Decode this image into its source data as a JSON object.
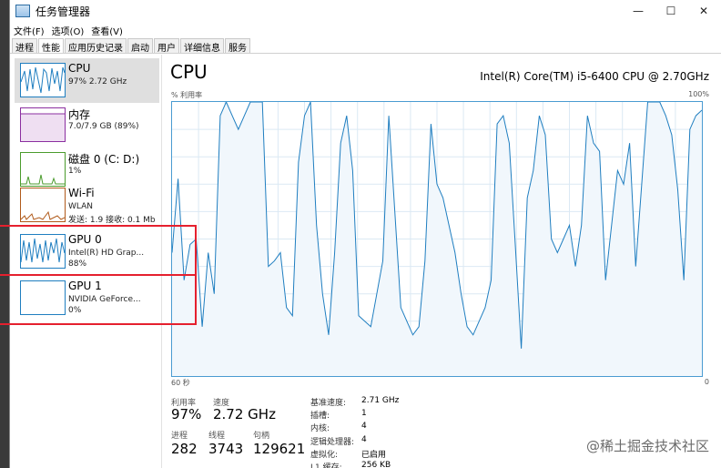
{
  "window": {
    "title": "任务管理器",
    "minimize": "—",
    "maximize": "☐",
    "close": "✕"
  },
  "menu": [
    "文件(F)",
    "选项(O)",
    "查看(V)"
  ],
  "tabs": [
    "进程",
    "性能",
    "应用历史记录",
    "启动",
    "用户",
    "详细信息",
    "服务"
  ],
  "sidebar": [
    {
      "name": "CPU",
      "line2": "97%  2.72 GHz",
      "line3": "",
      "color": "#1f7ec0"
    },
    {
      "name": "内存",
      "line2": "7.0/7.9 GB (89%)",
      "line3": "",
      "color": "#8b2fa0"
    },
    {
      "name": "磁盘 0 (C: D:)",
      "line2": "1%",
      "line3": "",
      "color": "#4b9b2d"
    },
    {
      "name": "Wi-Fi",
      "line2": "WLAN",
      "line3": "发送: 1.9  接收: 0.1 Mb",
      "color": "#b05a1a"
    },
    {
      "name": "GPU 0",
      "line2": "Intel(R) HD Grap...",
      "line3": "88%",
      "color": "#1f7ec0"
    },
    {
      "name": "GPU 1",
      "line2": "NVIDIA GeForce...",
      "line3": "0%",
      "color": "#1f7ec0"
    }
  ],
  "main": {
    "title": "CPU",
    "cpu_name": "Intel(R) Core(TM) i5-6400 CPU @ 2.70GHz",
    "ylabel": "% 利用率",
    "ymax": "100%",
    "xleft": "60 秒",
    "xright": "0"
  },
  "stats": {
    "util_label": "利用率",
    "util_value": "97%",
    "speed_label": "速度",
    "speed_value": "2.72 GHz",
    "proc_label": "进程",
    "proc_value": "282",
    "thread_label": "线程",
    "thread_value": "3743",
    "handle_label": "句柄",
    "handle_value": "129621"
  },
  "details": [
    {
      "label": "基准速度:",
      "value": "2.71 GHz"
    },
    {
      "label": "插槽:",
      "value": "1"
    },
    {
      "label": "内核:",
      "value": "4"
    },
    {
      "label": "逻辑处理器:",
      "value": "4"
    },
    {
      "label": "虚拟化:",
      "value": "已启用"
    },
    {
      "label": "L1 缓存:",
      "value": "256 KB"
    }
  ],
  "watermark": "@稀土掘金技术社区",
  "chart_data": {
    "type": "area",
    "ylim": [
      0,
      100
    ],
    "xlim": [
      60,
      0
    ],
    "values": [
      45,
      72,
      35,
      48,
      50,
      18,
      45,
      30,
      95,
      100,
      95,
      90,
      95,
      100,
      100,
      100,
      40,
      42,
      45,
      25,
      22,
      78,
      95,
      100,
      55,
      30,
      15,
      45,
      85,
      95,
      75,
      22,
      20,
      18,
      30,
      42,
      95,
      60,
      25,
      20,
      15,
      18,
      42,
      92,
      70,
      65,
      55,
      45,
      30,
      18,
      15,
      20,
      25,
      35,
      92,
      95,
      85,
      48,
      10,
      65,
      75,
      95,
      88,
      50,
      45,
      50,
      55,
      40,
      55,
      95,
      85,
      82,
      35,
      55,
      75,
      70,
      85,
      40,
      70,
      100,
      100,
      100,
      95,
      88,
      68,
      35,
      90,
      95,
      97
    ]
  }
}
